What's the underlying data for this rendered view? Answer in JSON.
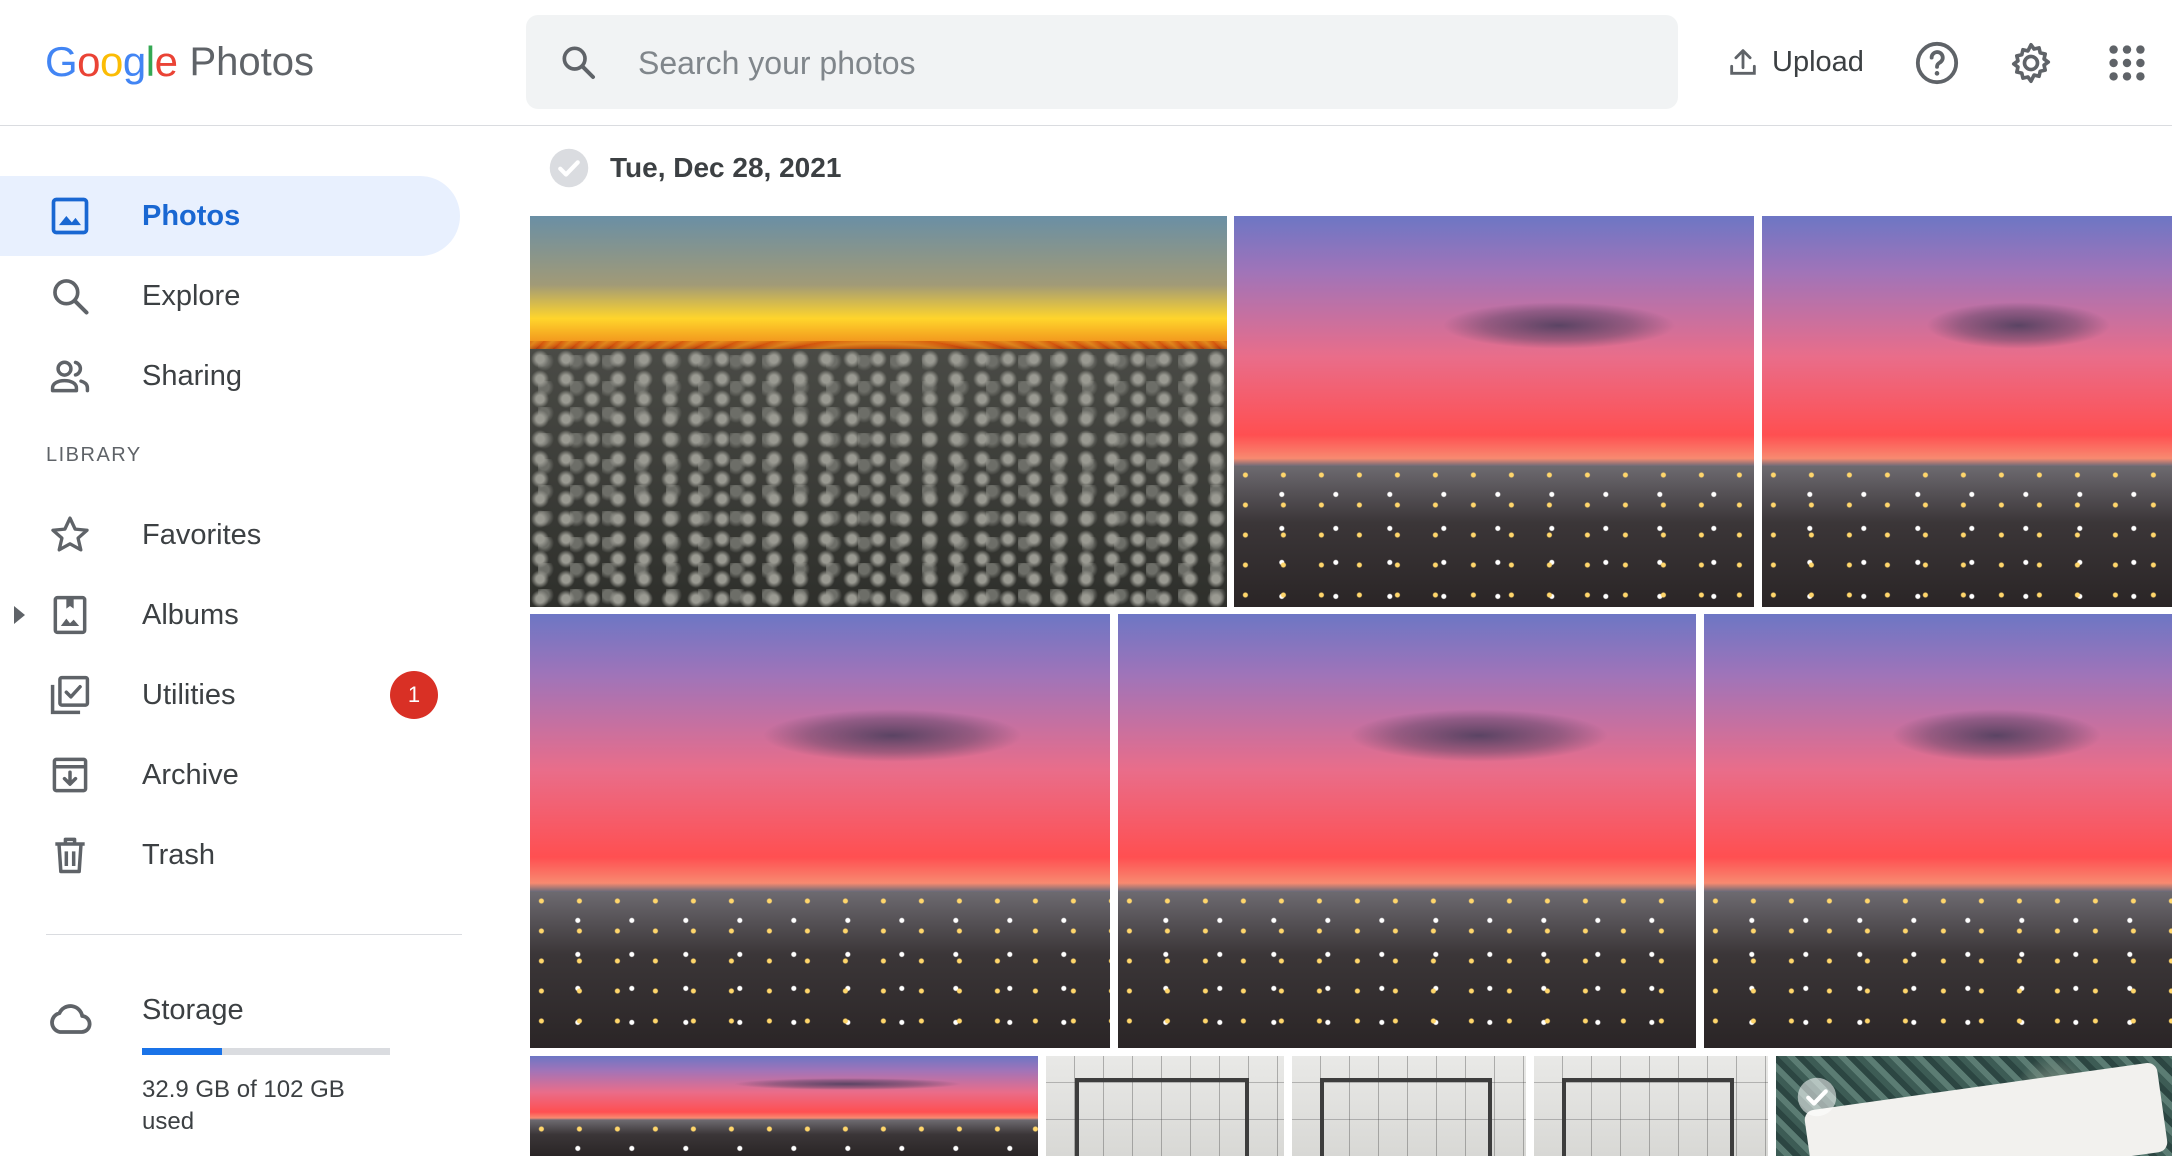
{
  "app": {
    "logo_letters": [
      {
        "char": "G",
        "color": "#4285F4"
      },
      {
        "char": "o",
        "color": "#EA4335"
      },
      {
        "char": "o",
        "color": "#FBBC05"
      },
      {
        "char": "g",
        "color": "#4285F4"
      },
      {
        "char": "l",
        "color": "#34A853"
      },
      {
        "char": "e",
        "color": "#EA4335"
      }
    ],
    "product": "Photos"
  },
  "search": {
    "placeholder": "Search your photos"
  },
  "header": {
    "upload_label": "Upload",
    "icons": [
      "upload-icon",
      "help-icon",
      "settings-gear-icon",
      "apps-grid-icon"
    ]
  },
  "sidebar": {
    "items": [
      {
        "label": "Photos",
        "icon": "photo-icon",
        "active": true
      },
      {
        "label": "Explore",
        "icon": "search-icon"
      },
      {
        "label": "Sharing",
        "icon": "people-icon"
      }
    ],
    "library_heading": "LIBRARY",
    "library_items": [
      {
        "label": "Favorites",
        "icon": "star-icon"
      },
      {
        "label": "Albums",
        "icon": "album-icon",
        "expandable": true
      },
      {
        "label": "Utilities",
        "icon": "utilities-icon",
        "badge": "1"
      },
      {
        "label": "Archive",
        "icon": "archive-icon"
      },
      {
        "label": "Trash",
        "icon": "trash-icon"
      }
    ],
    "storage": {
      "label": "Storage",
      "used_text": "32.9 GB of 102 GB used",
      "used_fraction": 0.323,
      "icon": "cloud-icon"
    }
  },
  "main": {
    "date_heading": "Tue, Dec 28, 2021",
    "photos": [
      {
        "kind": "clouds-at-sunset"
      },
      {
        "kind": "town-sunset"
      },
      {
        "kind": "town-sunset"
      },
      {
        "kind": "town-sunset"
      },
      {
        "kind": "town-sunset"
      },
      {
        "kind": "town-sunset"
      },
      {
        "kind": "town-sunset"
      },
      {
        "kind": "floor-plan"
      },
      {
        "kind": "floor-plan"
      },
      {
        "kind": "floor-plan"
      },
      {
        "kind": "map-print"
      }
    ]
  },
  "colors": {
    "accent": "#1a73e8",
    "active_nav_bg": "#e8f0fe",
    "badge": "#d93025"
  }
}
